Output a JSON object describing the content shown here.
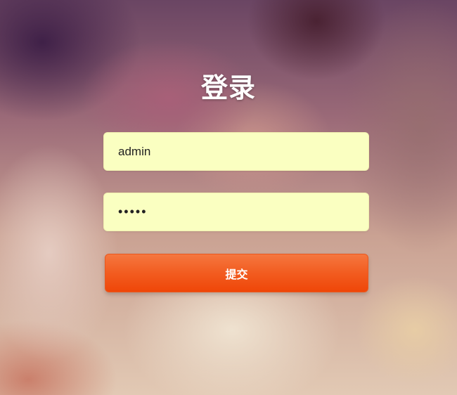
{
  "login": {
    "title": "登录",
    "username_value": "admin",
    "password_value": "•••••",
    "submit_label": "提交"
  },
  "colors": {
    "input_background": "#faffc1",
    "button_accent": "#f25c20",
    "title_text": "#ffffff"
  }
}
